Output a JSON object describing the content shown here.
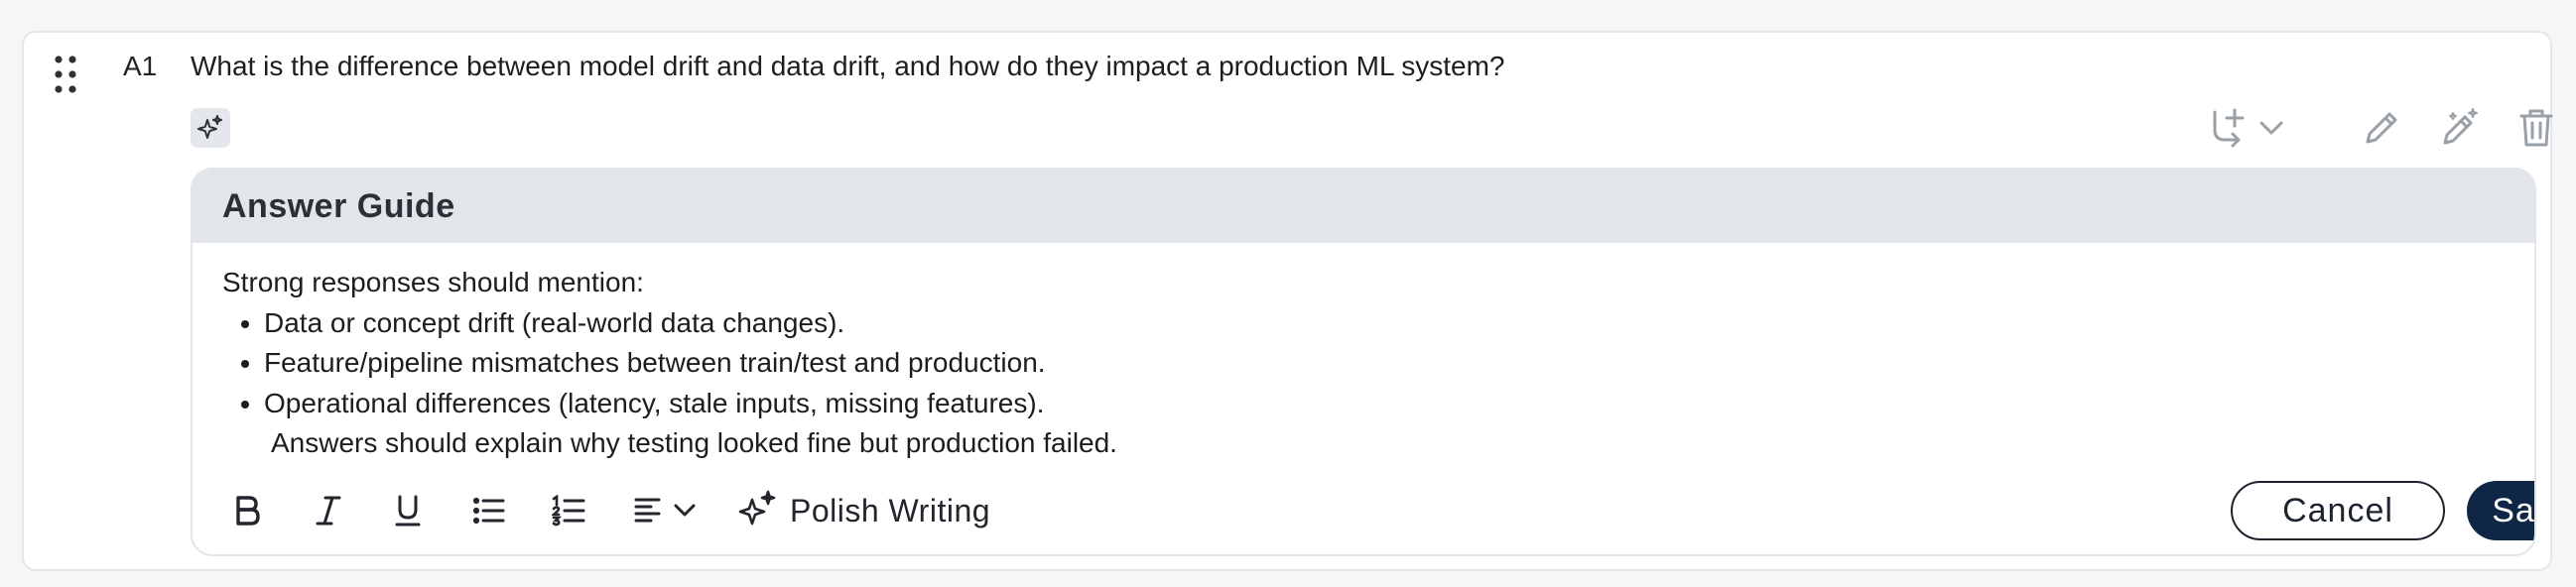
{
  "question": {
    "number": "A1",
    "text": "What is the difference between model drift and data drift, and how do they impact a production ML system?"
  },
  "icons": {
    "drag": "drag-handle-icon",
    "ai_badge": "sparkle-icon",
    "branch": "branch-add-icon",
    "edit": "pencil-icon",
    "ai_edit": "magic-pencil-icon",
    "delete": "trash-icon"
  },
  "answer_guide": {
    "title": "Answer Guide",
    "intro": "Strong responses should mention:",
    "bullets": [
      "Data or concept drift (real-world data changes).",
      "Feature/pipeline mismatches between train/test and production.",
      "Operational differences (latency, stale inputs, missing features)."
    ],
    "continuation": "Answers should explain why testing looked fine but production failed."
  },
  "editor_toolbar": {
    "polish_label": "Polish Writing",
    "cancel_label": "Cancel",
    "save_label": "Save"
  },
  "colors": {
    "primary": "#0f2646",
    "header_bg": "#e2e5ea",
    "border": "#e4e6ea",
    "icon": "#8a8f98"
  }
}
